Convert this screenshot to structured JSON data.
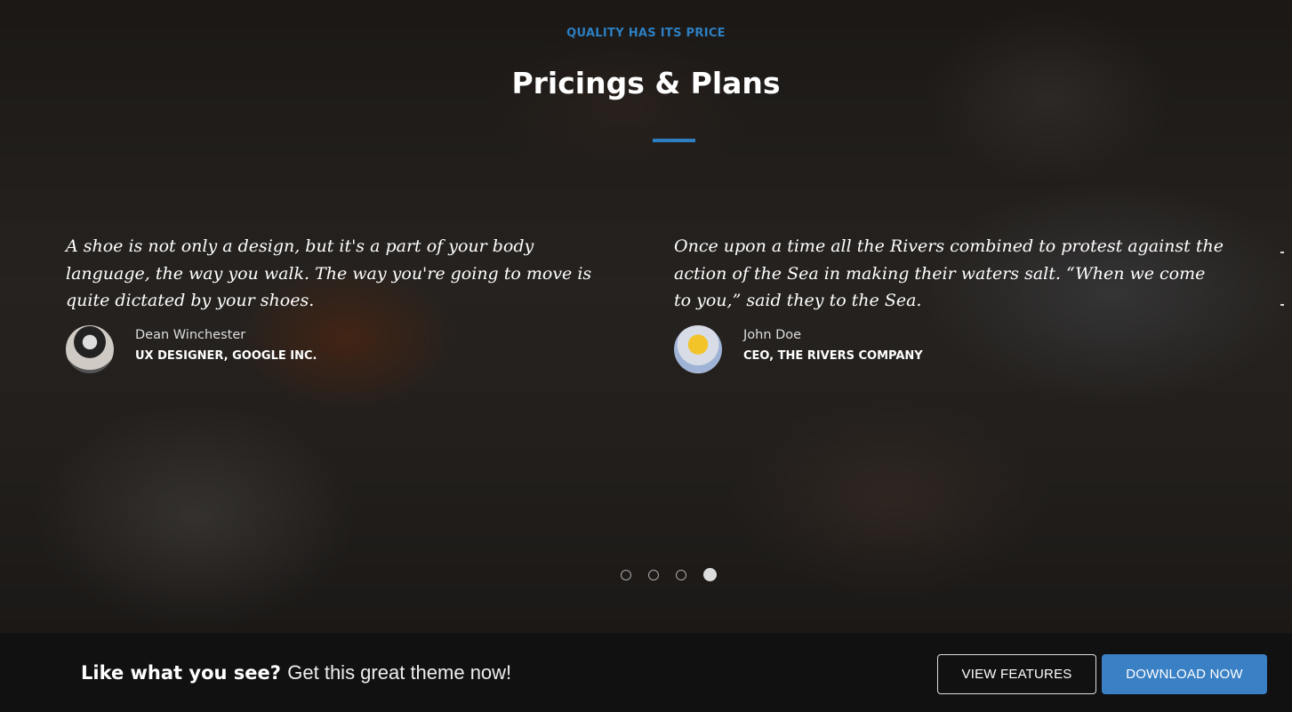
{
  "hero": {
    "eyebrow": "QUALITY HAS ITS PRICE",
    "title": "Pricings & Plans"
  },
  "testimonials": [
    {
      "quote": "A shoe is not only a design, but it's a part of your body language, the way you walk. The way you're going to move is quite dictated by your shoes.",
      "name": "Dean Winchester",
      "role": "UX DESIGNER, GOOGLE INC."
    },
    {
      "quote": "Once upon a time all the Rivers combined to protest against the action of the Sea in making their waters salt. “When we come to you,” said they to the Sea.",
      "name": "John Doe",
      "role": "CEO, THE RIVERS COMPANY"
    }
  ],
  "carousel": {
    "slide_count": 4,
    "active_index": 3
  },
  "cta": {
    "strong": "Like what you see?",
    "text": "Get this great theme now!",
    "view_features": "VIEW FEATURES",
    "download_now": "DOWNLOAD NOW"
  },
  "colors": {
    "accent": "#2d7fc1",
    "button_primary": "#3a80c5",
    "footer_bg": "#111111"
  }
}
